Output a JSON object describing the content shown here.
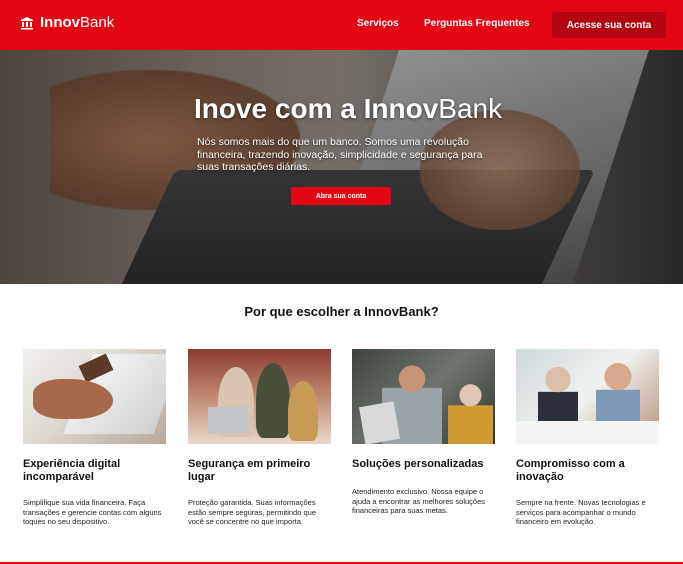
{
  "brand": {
    "name_bold": "Innov",
    "name_light": "Bank",
    "icon": "bank-icon"
  },
  "nav": {
    "items": [
      {
        "label": "Serviços"
      },
      {
        "label": "Perguntas Frequentes"
      }
    ],
    "cta_label": "Acesse sua conta"
  },
  "hero": {
    "title_prefix": "Inove com a ",
    "title_bold": "Innov",
    "title_light": "Bank",
    "text": "Nós somos mais do que um banco. Somos uma revolução financeira, trazendo inovação, simplicidade e segurança para suas transações diárias.",
    "button_label": "Abra sua conta"
  },
  "why": {
    "title": "Por que escolher a InnovBank?",
    "cards": [
      {
        "title": "Experiência digital incomparável",
        "text": "Simplifique sua vida financeira. Faça transações e gerencie contas com alguns toques no seu dispositivo."
      },
      {
        "title": "Segurança em primeiro lugar",
        "text": "Proteção garantida. Suas informações estão sempre seguras, permitindo que você se concentre no que importa."
      },
      {
        "title": "Soluções personalizadas",
        "text": "Atendimento exclusivo. Nossa equipe o ajuda a encontrar as melhores soluções financeiras para suas metas."
      },
      {
        "title": "Compromisso com a inovação",
        "text": "Sempre na frente. Novas tecnologias e serviços para acompanhar o mundo financeiro em evolução."
      }
    ]
  },
  "colors": {
    "brand_red": "#e30613",
    "dark_red": "#b4040f"
  }
}
